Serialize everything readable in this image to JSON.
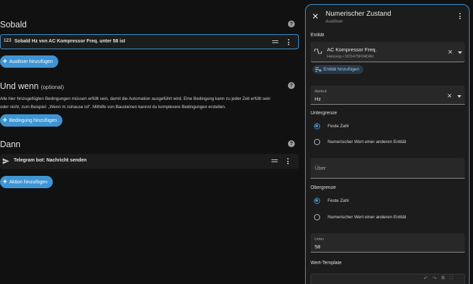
{
  "when": {
    "title": "Sobald",
    "trigger_icon": "123",
    "trigger_label": "Sobald Hz von AC Kompressor Freq. unter 58 ist",
    "add_label": "Auslöser hinzufügen"
  },
  "and_if": {
    "title": "Und wenn",
    "optional": "(optional)",
    "note_line1": "Alle hier hinzugefügten Bedingungen müssen erfüllt sein, damit die Automation ausgeführt wird. Eine Bedingung kann zu jeder Zeit erfüllt sein",
    "note_line2": "oder nicht, zum Beispiel: „Wenn m zuhause ist“. Mithilfe von Bausteinen kannst du komplexere Bedingungen erstellen.",
    "add_label": "Bedingung hinzufügen"
  },
  "then": {
    "title": "Dann",
    "action_label": "Telegram bot: Nachricht senden",
    "add_label": "Aktion hinzufügen"
  },
  "panel": {
    "title": "Numerischer Zustand",
    "subtitle": "Auslöser",
    "entity_label": "Entität",
    "entity_name": "AC Kompressor Freq.",
    "entity_area": "Heizung",
    "entity_sep": "•",
    "entity_id": "DC5475F04DA0",
    "add_entity_label": "Entität hinzufügen",
    "attribute_label": "Attribut",
    "attribute_value": "Hz",
    "lower_label": "Untergrenze",
    "fixed_number": "Feste Zahl",
    "other_entity_value": "Numerischer Wert einer anderen Entität",
    "above_placeholder": "Über",
    "upper_label": "Obergrenze",
    "fixed_number_2": "Feste Zahl",
    "other_entity_value_2": "Numerischer Wert einer anderen Entität",
    "below_label": "Unter",
    "below_value": "58",
    "value_template_label": "Wert-Template"
  },
  "colors": {
    "accent": "#3f95d3",
    "background": "#111111",
    "card": "#1c1c1c"
  },
  "icons": {
    "close": "close-icon",
    "entity": "sine-wave-icon",
    "help": "help-circle-icon",
    "telegram": "send-icon"
  }
}
